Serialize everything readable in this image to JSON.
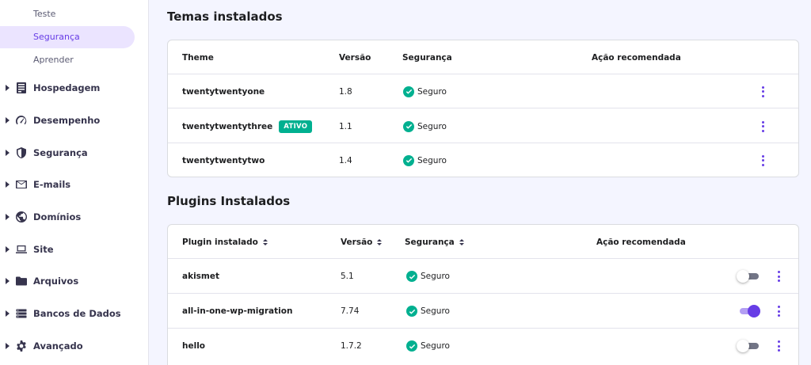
{
  "sidebar": {
    "sub_items": [
      {
        "label": "Teste"
      },
      {
        "label": "Segurança"
      },
      {
        "label": "Aprender"
      }
    ],
    "items": [
      {
        "label": "Hospedagem",
        "icon": "server-icon"
      },
      {
        "label": "Desempenho",
        "icon": "speedometer-icon"
      },
      {
        "label": "Segurança",
        "icon": "shield-icon"
      },
      {
        "label": "E-mails",
        "icon": "mail-icon"
      },
      {
        "label": "Domínios",
        "icon": "globe-icon"
      },
      {
        "label": "Site",
        "icon": "laptop-icon"
      },
      {
        "label": "Arquivos",
        "icon": "folder-icon"
      },
      {
        "label": "Bancos de Dados",
        "icon": "database-icon"
      },
      {
        "label": "Avançado",
        "icon": "gear-icon"
      }
    ]
  },
  "themes": {
    "title": "Temas instalados",
    "headers": {
      "name": "Theme",
      "version": "Versão",
      "security": "Segurança",
      "action": "Ação recomendada"
    },
    "rows": [
      {
        "name": "twentytwentyone",
        "badge": "",
        "version": "1.8",
        "security": "Seguro"
      },
      {
        "name": "twentytwentythree",
        "badge": "ATIVO",
        "version": "1.1",
        "security": "Seguro"
      },
      {
        "name": "twentytwentytwo",
        "badge": "",
        "version": "1.4",
        "security": "Seguro"
      }
    ]
  },
  "plugins": {
    "title": "Plugins Instalados",
    "headers": {
      "name": "Plugin instalado",
      "version": "Versão",
      "security": "Segurança",
      "action": "Ação recomendada"
    },
    "rows": [
      {
        "name": "akismet",
        "version": "5.1",
        "security": "Seguro",
        "enabled": false
      },
      {
        "name": "all-in-one-wp-migration",
        "version": "7.74",
        "security": "Seguro",
        "enabled": true
      },
      {
        "name": "hello",
        "version": "1.7.2",
        "security": "Seguro",
        "enabled": false
      }
    ]
  },
  "colors": {
    "accent": "#673de6",
    "success": "#00b090",
    "sidebar_active_bg": "#ebe4ff",
    "page_bg": "#f4f5ff"
  }
}
